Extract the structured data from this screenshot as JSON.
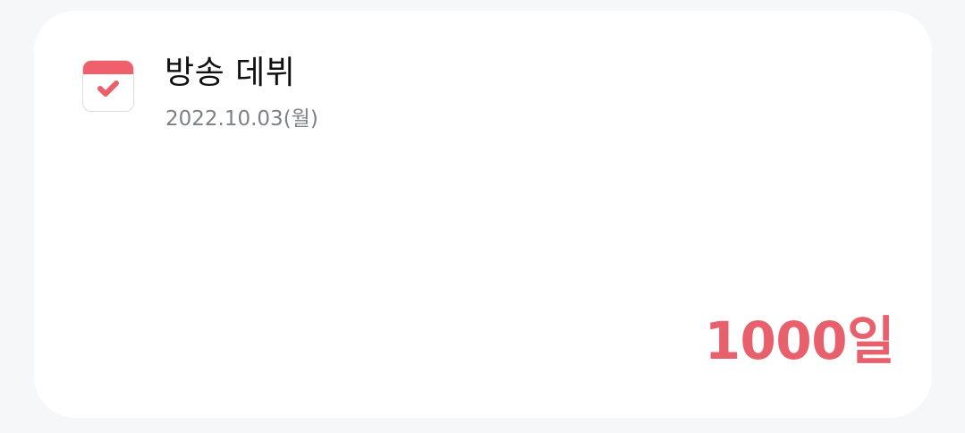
{
  "event": {
    "title": "방송 데뷔",
    "date": "2022.10.03(월)",
    "dday_label": "1000일",
    "icon": "calendar-check-icon"
  },
  "colors": {
    "accent": "#e8606c",
    "title": "#111111",
    "date": "#7d8087",
    "card_bg": "#ffffff",
    "page_bg": "#f6f7f9"
  }
}
